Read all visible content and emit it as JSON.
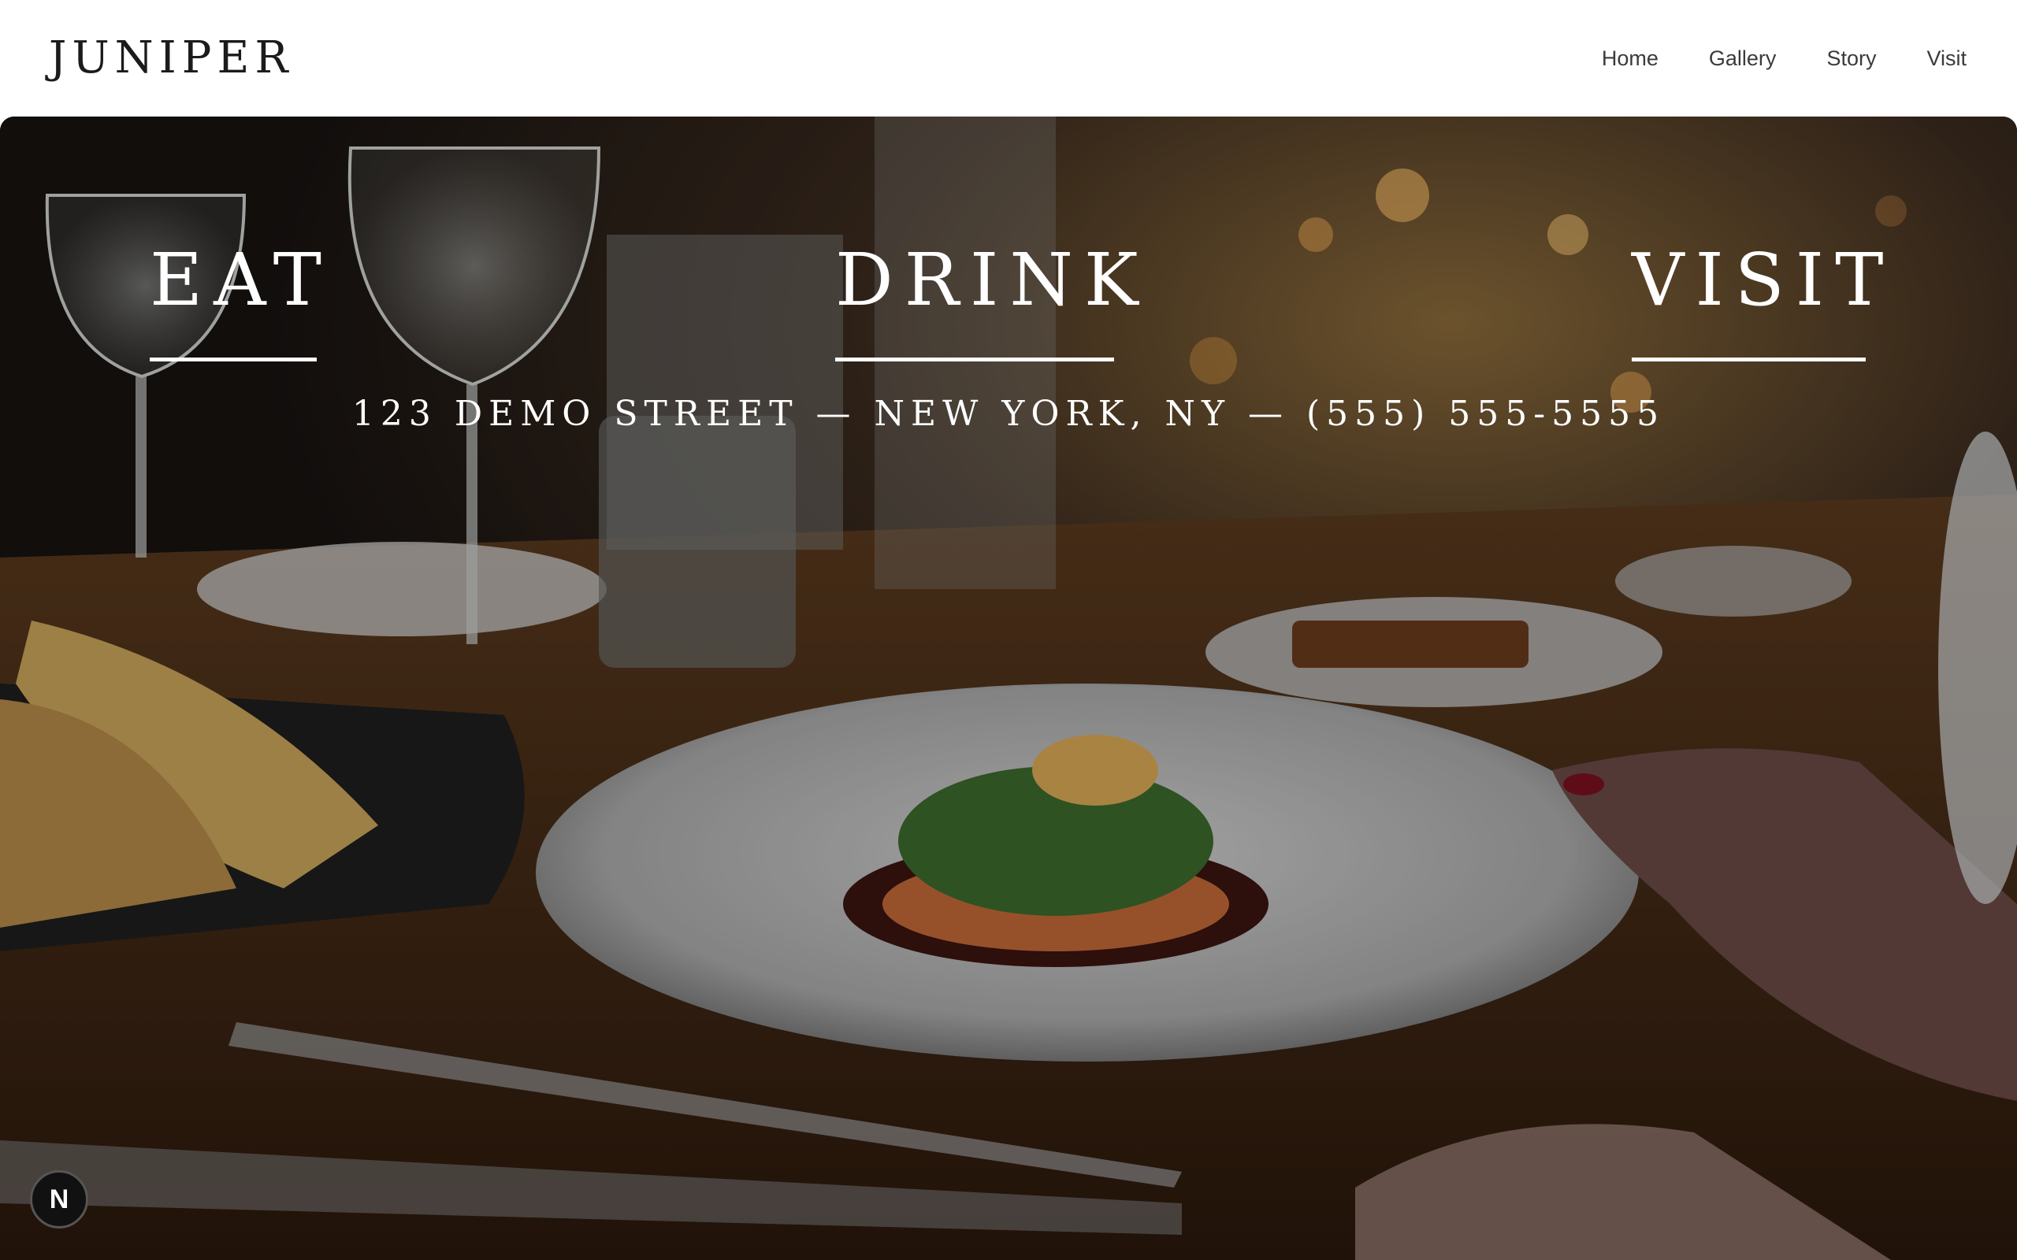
{
  "brand": {
    "logo": "JUNIPER"
  },
  "nav": {
    "items": [
      {
        "label": "Home"
      },
      {
        "label": "Gallery"
      },
      {
        "label": "Story"
      },
      {
        "label": "Visit"
      }
    ]
  },
  "hero": {
    "sections": [
      {
        "label": "EAT"
      },
      {
        "label": "DRINK"
      },
      {
        "label": "VISIT"
      }
    ],
    "address": "123 DEMO STREET — NEW YORK, NY — (555) 555-5555",
    "image_description_icon": "restaurant-dinner-photo"
  },
  "badge": {
    "label": "N",
    "icon": "nextjs-icon"
  },
  "colors": {
    "header_bg": "#ffffff",
    "text_dark": "#1b1b1b",
    "hero_text": "#ffffff"
  }
}
